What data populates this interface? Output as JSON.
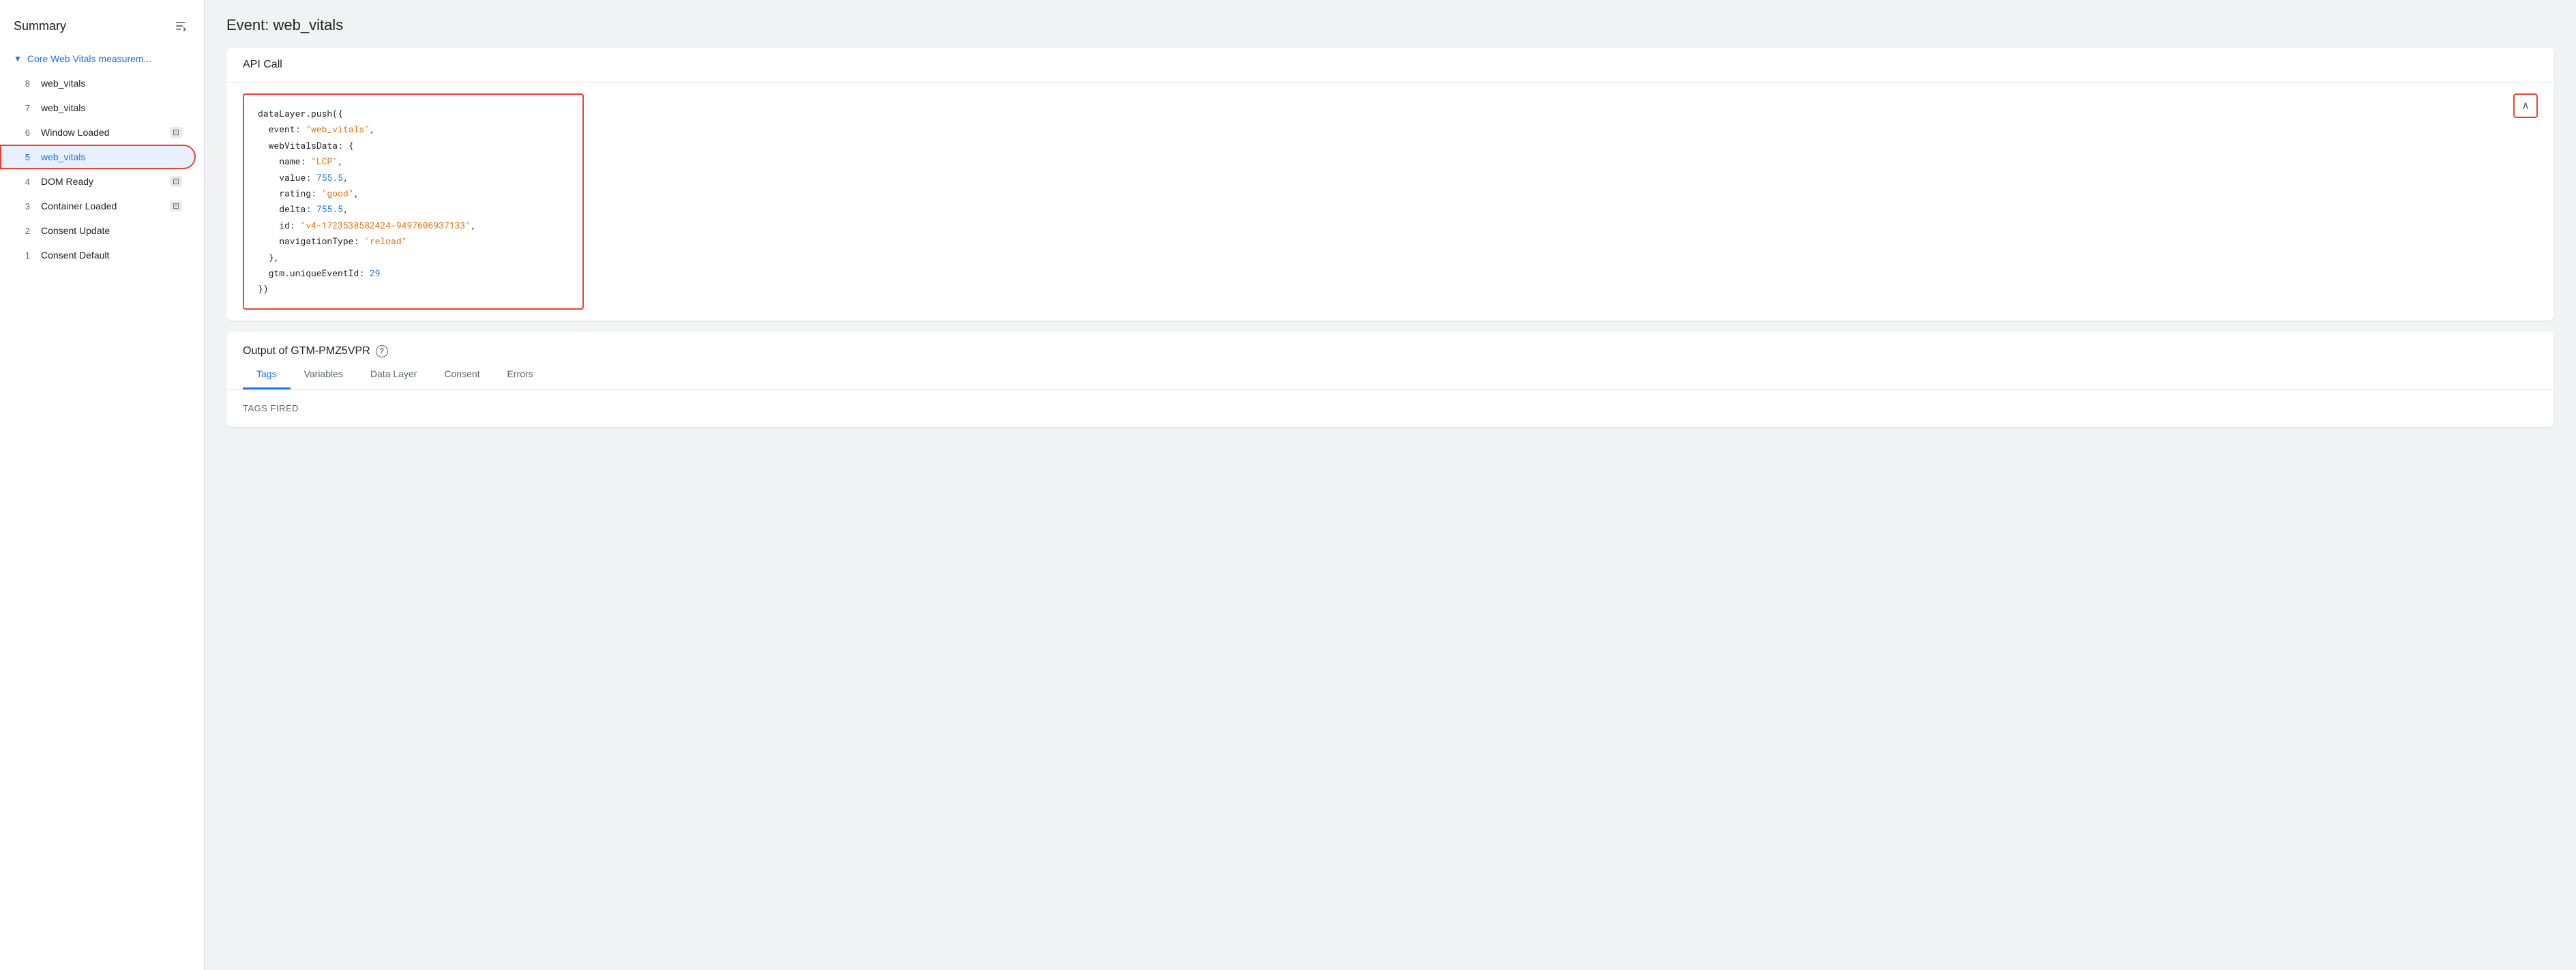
{
  "sidebar": {
    "title": "Summary",
    "group": {
      "label": "Core Web Vitals measurem...",
      "chevron": "▼"
    },
    "items": [
      {
        "num": "8",
        "label": "web_vitals",
        "icon": null,
        "active": false
      },
      {
        "num": "7",
        "label": "web_vitals",
        "icon": null,
        "active": false
      },
      {
        "num": "6",
        "label": "Window Loaded",
        "icon": "◻",
        "active": false
      },
      {
        "num": "5",
        "label": "web_vitals",
        "icon": null,
        "active": true
      },
      {
        "num": "4",
        "label": "DOM Ready",
        "icon": "◻",
        "active": false
      },
      {
        "num": "3",
        "label": "Container Loaded",
        "icon": "◻",
        "active": false
      },
      {
        "num": "2",
        "label": "Consent Update",
        "icon": null,
        "active": false
      },
      {
        "num": "1",
        "label": "Consent Default",
        "icon": null,
        "active": false
      }
    ]
  },
  "page_title": "Event: web_vitals",
  "api_call": {
    "section_label": "API Call",
    "code": {
      "line1": "dataLayer.push({",
      "line2_key": "  event: ",
      "line2_val": "\"web_vitals\"",
      "line2_end": ",",
      "line3": "  webVitalsData: {",
      "line4_key": "    name: ",
      "line4_val": "\"LCP\"",
      "line4_end": ",",
      "line5_key": "    value: ",
      "line5_val": "755.5",
      "line5_end": ",",
      "line6_key": "    rating: ",
      "line6_val": "\"good\"",
      "line6_end": ",",
      "line7_key": "    delta: ",
      "line7_val": "755.5",
      "line7_end": ",",
      "line8_key": "    id: ",
      "line8_val": "\"v4-1723538582424-9497606937133\"",
      "line8_end": ",",
      "line9_key": "    navigationType: ",
      "line9_val": "\"reload\"",
      "line10": "  },",
      "line11_key": "  gtm.uniqueEventId: ",
      "line11_val": "29",
      "line12": "})"
    },
    "collapse_btn": "∧"
  },
  "output": {
    "label": "Output of GTM-PMZ5VPR",
    "help_label": "?",
    "tabs": [
      {
        "id": "tags",
        "label": "Tags",
        "active": true
      },
      {
        "id": "variables",
        "label": "Variables",
        "active": false
      },
      {
        "id": "data-layer",
        "label": "Data Layer",
        "active": false
      },
      {
        "id": "consent",
        "label": "Consent",
        "active": false
      },
      {
        "id": "errors",
        "label": "Errors",
        "active": false
      }
    ],
    "tags_fired_label": "Tags Fired"
  }
}
